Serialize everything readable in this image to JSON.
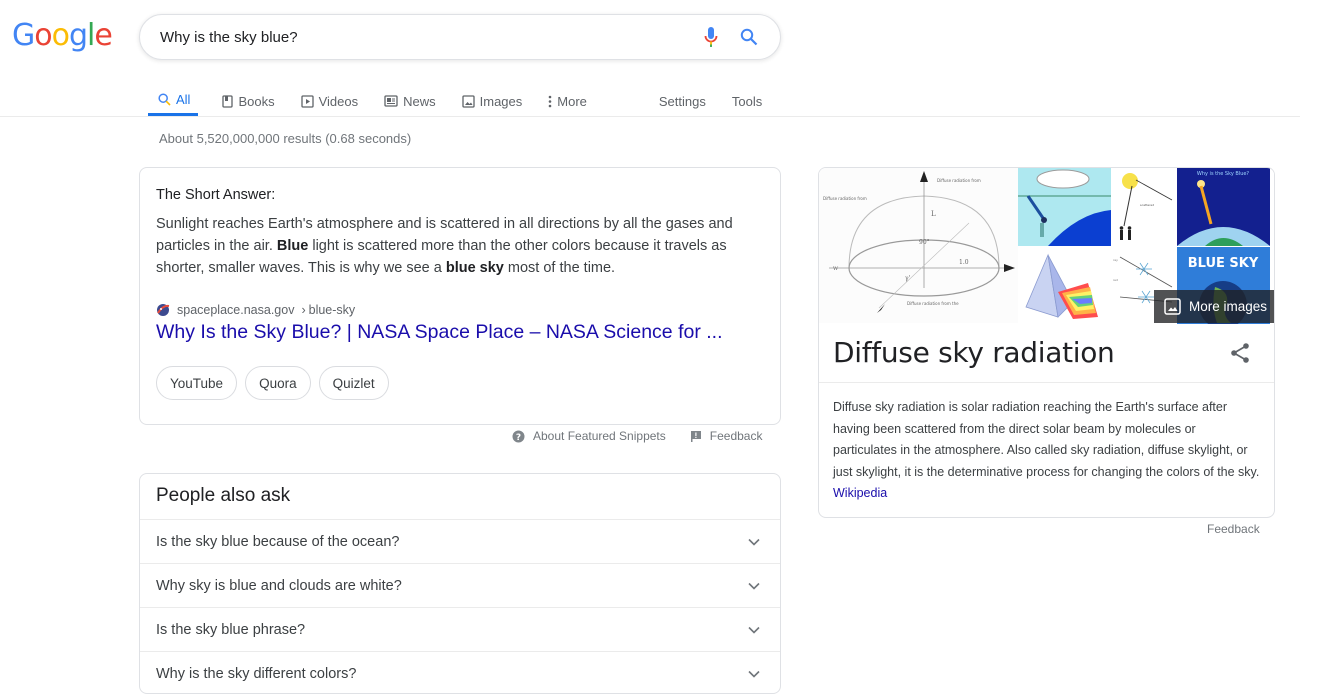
{
  "header": {
    "logo_letters": [
      "G",
      "o",
      "o",
      "g",
      "l",
      "e"
    ],
    "search_query": "Why is the sky blue?",
    "icons": {
      "voice": "microphone-icon",
      "search": "search-icon"
    }
  },
  "tabs": [
    {
      "label": "All",
      "icon": "search-icon",
      "active": true
    },
    {
      "label": "Books",
      "icon": "book-icon",
      "active": false
    },
    {
      "label": "Videos",
      "icon": "play-icon",
      "active": false
    },
    {
      "label": "News",
      "icon": "news-icon",
      "active": false
    },
    {
      "label": "Images",
      "icon": "image-icon",
      "active": false
    },
    {
      "label": "More",
      "icon": "more-vert-icon",
      "active": false
    }
  ],
  "tools": {
    "settings": "Settings",
    "tools": "Tools"
  },
  "result_stats": "About 5,520,000,000 results (0.68 seconds)",
  "featured_snippet": {
    "heading": "The Short Answer:",
    "body_parts": [
      "Sunlight reaches Earth's atmosphere and is scattered in all directions by all the gases and particles in the air. ",
      "Blue",
      " light is scattered more than the other colors because it travels as shorter, smaller waves. This is why we see a ",
      "blue sky",
      " most of the time."
    ],
    "source_domain": "spaceplace.nasa.gov",
    "source_path": "blue-sky",
    "breadcrumb_sep": "›",
    "title": "Why Is the Sky Blue? | NASA Space Place – NASA Science for ...",
    "chips": [
      "YouTube",
      "Quora",
      "Quizlet"
    ],
    "footer": {
      "about": "About Featured Snippets",
      "feedback": "Feedback"
    }
  },
  "people_also_ask": {
    "title": "People also ask",
    "questions": [
      "Is the sky blue because of the ocean?",
      "Why sky is blue and clouds are white?",
      "Is the sky blue phrase?",
      "Why is the sky different colors?"
    ]
  },
  "knowledge_panel": {
    "more_images": "More images",
    "image_texts": {
      "blue_sky_tile": "BLUE SKY",
      "poster_tile": "Why is the Sky Blue?"
    },
    "title": "Diffuse sky radiation",
    "description": "Diffuse sky radiation is solar radiation reaching the Earth's surface after having been scattered from the direct solar beam by molecules or particulates in the atmosphere. Also called sky radiation, diffuse skylight, or just skylight, it is the determinative process for changing the colors of the sky. ",
    "source_link": "Wikipedia",
    "feedback": "Feedback"
  },
  "colors": {
    "google_blue": "#4285f4",
    "google_red": "#ea4335",
    "google_yellow": "#fbbc05",
    "google_green": "#34a853",
    "link": "#1a0dab",
    "active_tab": "#1a73e8"
  }
}
